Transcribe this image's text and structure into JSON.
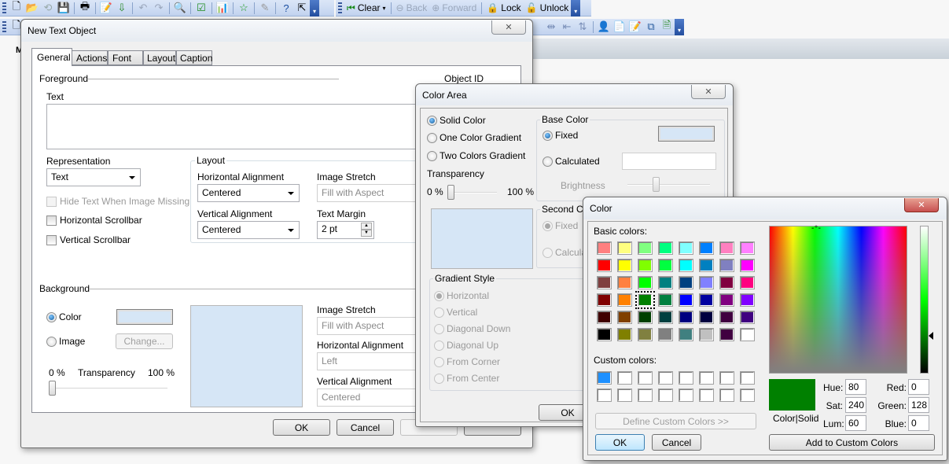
{
  "toolbar1": {
    "icons": [
      "new-document-icon",
      "open-folder-icon",
      "reload-icon",
      "save-icon",
      "print-icon",
      "edit-script-icon",
      "import-icon",
      "undo-icon",
      "redo-icon",
      "find-icon",
      "checkmark-icon",
      "chart-icon",
      "star-icon",
      "edit-icon",
      "help-icon",
      "whats-this-icon"
    ],
    "clear_label": "Clear",
    "back_label": "Back",
    "forward_label": "Forward",
    "lock_label": "Lock",
    "unlock_label": "Unlock"
  },
  "toolbar2": {
    "icons": [
      "align-distribute-icon",
      "align-left-icon",
      "sort-icon",
      "design-user-icon",
      "properties-icon",
      "edit-object-icon",
      "sheet-tree-icon",
      "document-web-icon"
    ]
  },
  "behind_text": "M",
  "text_object_dialog": {
    "title": "New Text Object",
    "tabs": [
      "General",
      "Actions",
      "Font",
      "Layout",
      "Caption"
    ],
    "active_tab": "General",
    "foreground_label": "Foreground",
    "object_id_label": "Object ID",
    "text_label": "Text",
    "text_value": "",
    "representation_label": "Representation",
    "representation_value": "Text",
    "hide_text_label": "Hide Text When Image Missing",
    "hscroll_label": "Horizontal Scrollbar",
    "vscroll_label": "Vertical Scrollbar",
    "layout_group": "Layout",
    "h_align_label": "Horizontal Alignment",
    "h_align_value": "Centered",
    "image_stretch_label": "Image Stretch",
    "image_stretch_value": "Fill with Aspect",
    "v_align_label": "Vertical Alignment",
    "v_align_value": "Centered",
    "text_margin_label": "Text Margin",
    "text_margin_value": "2 pt",
    "background_label": "Background",
    "color_radio": "Color",
    "image_radio": "Image",
    "change_button": "Change...",
    "transparency_min": "0 %",
    "transparency_label": "Transparency",
    "transparency_max": "100 %",
    "transparency_value": 0,
    "bg_image_stretch_label": "Image Stretch",
    "bg_image_stretch_value": "Fill with Aspect",
    "bg_h_align_label": "Horizontal Alignment",
    "bg_h_align_value": "Left",
    "bg_v_align_label": "Vertical Alignment",
    "bg_v_align_value": "Centered",
    "background_color": "#d6e6f6",
    "ok": "OK",
    "cancel": "Cancel"
  },
  "color_area_dialog": {
    "title": "Color Area",
    "solid": "Solid Color",
    "one_gradient": "One Color Gradient",
    "two_gradient": "Two Colors Gradient",
    "transparency_label": "Transparency",
    "transparency_min": "0 %",
    "transparency_max": "100 %",
    "base_color_group": "Base Color",
    "fixed": "Fixed",
    "calculated": "Calculated",
    "brightness": "Brightness",
    "second_color_group": "Second Co",
    "second_fixed": "Fixed",
    "second_calculated": "Calculat",
    "gradient_style_group": "Gradient Style",
    "gradient_styles": [
      "Horizontal",
      "Vertical",
      "Diagonal Down",
      "Diagonal Up",
      "From Corner",
      "From Center"
    ],
    "ok": "OK",
    "base_color": "#d6e6f6"
  },
  "color_dialog": {
    "title": "Color",
    "basic_colors_label": "Basic colors:",
    "basic_colors": [
      "#ff8080",
      "#ffff80",
      "#80ff80",
      "#00ff80",
      "#80ffff",
      "#0080ff",
      "#ff80c0",
      "#ff80ff",
      "#ff0000",
      "#ffff00",
      "#80ff00",
      "#00ff40",
      "#00ffff",
      "#0080c0",
      "#8080c0",
      "#ff00ff",
      "#804040",
      "#ff8040",
      "#00ff00",
      "#008080",
      "#004080",
      "#8080ff",
      "#800040",
      "#ff0080",
      "#800000",
      "#ff8000",
      "#008000",
      "#008040",
      "#0000ff",
      "#0000a0",
      "#800080",
      "#8000ff",
      "#400000",
      "#804000",
      "#004000",
      "#004040",
      "#000080",
      "#000040",
      "#400040",
      "#400080",
      "#000000",
      "#808000",
      "#808040",
      "#808080",
      "#408080",
      "#c0c0c0",
      "#400040",
      "#ffffff"
    ],
    "selected_index": 26,
    "custom_colors_label": "Custom colors:",
    "custom_colors": [
      "#1e90ff",
      "#ffffff",
      "#ffffff",
      "#ffffff",
      "#ffffff",
      "#ffffff",
      "#ffffff",
      "#ffffff",
      "#ffffff",
      "#ffffff",
      "#ffffff",
      "#ffffff",
      "#ffffff",
      "#ffffff",
      "#ffffff",
      "#ffffff"
    ],
    "define_custom": "Define Custom Colors >>",
    "ok": "OK",
    "cancel": "Cancel",
    "color_solid_label": "Color|Solid",
    "current_color": "#008000",
    "hue_label": "Hue:",
    "hue": "80",
    "sat_label": "Sat:",
    "sat": "240",
    "lum_label": "Lum:",
    "lum": "60",
    "red_label": "Red:",
    "red": "0",
    "green_label": "Green:",
    "green": "128",
    "blue_label": "Blue:",
    "blue": "0",
    "add_custom": "Add to Custom Colors"
  }
}
